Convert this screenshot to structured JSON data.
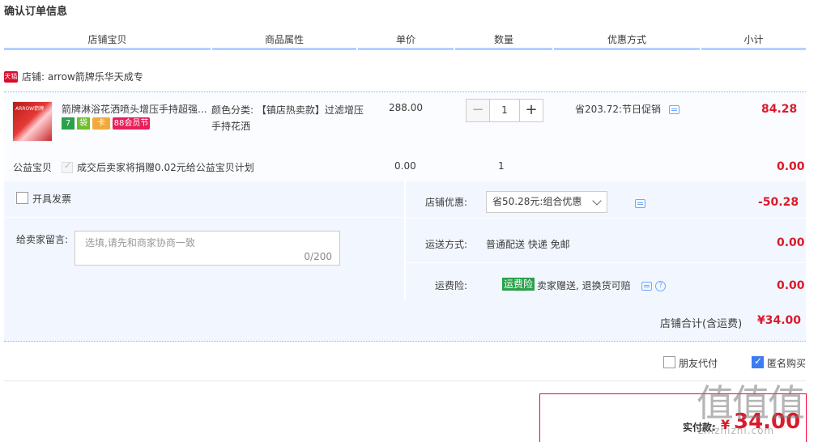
{
  "page_title": "确认订单信息",
  "columns": [
    "店铺宝贝",
    "商品属性",
    "单价",
    "数量",
    "优惠方式",
    "小计"
  ],
  "shop": {
    "badge": "天猫",
    "label": "店铺: arrow箭牌乐华天成专"
  },
  "item": {
    "thumb_text": "ARROW箭牌",
    "title": "箭牌淋浴花洒喷头增压手持超强...",
    "icons": {
      "seven": "7",
      "bag": "袋",
      "card": "卡",
      "promo": "88会员节"
    },
    "attr": "颜色分类: 【镇店热卖款】过滤增压手持花洒",
    "price": "288.00",
    "qty": "1",
    "minus": "−",
    "plus": "+",
    "promo": "省203.72:节日促销",
    "subtotal": "84.28"
  },
  "charity": {
    "label": "公益宝贝",
    "text": "成交后卖家将捐赠0.02元给公益宝贝计划",
    "price": "0.00",
    "qty": "1",
    "subtotal": "0.00"
  },
  "invoice_label": "开具发票",
  "message": {
    "label": "给卖家留言:",
    "placeholder": "选填,请先和商家协商一致",
    "count": "0/200"
  },
  "shop_discount": {
    "label": "店铺优惠:",
    "selected": "省50.28元:组合优惠",
    "value": "-50.28"
  },
  "shipping": {
    "label": "运送方式:",
    "method": "普通配送 快递 免邮",
    "value": "0.00"
  },
  "insurance": {
    "label": "运费险:",
    "badge": "运费险",
    "text": "卖家赠送, 退换货可赔",
    "help": "?",
    "value": "0.00"
  },
  "shop_total": {
    "label": "店铺合计(含运费)",
    "value": "¥34.00"
  },
  "options": {
    "friend_pay": "朋友代付",
    "anonymous": "匿名购买"
  },
  "payment": {
    "label": "实付款:",
    "currency": "¥",
    "value": "34.00"
  },
  "watermark": {
    "main": "值值值",
    "sub": "zhizhizhi.com"
  },
  "colors": {
    "price_red": "#d91b2d",
    "header_blue": "#b2d1ff",
    "panel_bg": "#f2f7ff",
    "tmall_red": "#d80b2b",
    "insurance_green": "#2aa14a"
  }
}
